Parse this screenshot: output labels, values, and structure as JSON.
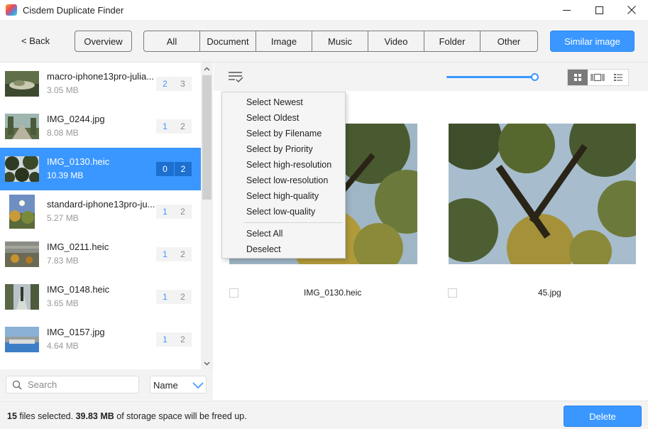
{
  "window": {
    "title": "Cisdem Duplicate Finder"
  },
  "toolbar": {
    "back_label": "< Back",
    "overview_label": "Overview",
    "tabs": [
      "All",
      "Document",
      "Image",
      "Music",
      "Video",
      "Folder",
      "Other"
    ],
    "similar_image_label": "Similar image"
  },
  "file_list": [
    {
      "name": "macro-iphone13pro-julia...",
      "size": "3.05 MB",
      "count_selected": "2",
      "count_total": "3",
      "selected": false
    },
    {
      "name": "IMG_0244.jpg",
      "size": "8.08 MB",
      "count_selected": "1",
      "count_total": "2",
      "selected": false
    },
    {
      "name": "IMG_0130.heic",
      "size": "10.39 MB",
      "count_selected": "0",
      "count_total": "2",
      "selected": true
    },
    {
      "name": "standard-iphone13pro-ju...",
      "size": "5.27 MB",
      "count_selected": "1",
      "count_total": "2",
      "selected": false
    },
    {
      "name": "IMG_0211.heic",
      "size": "7.83 MB",
      "count_selected": "1",
      "count_total": "2",
      "selected": false
    },
    {
      "name": "IMG_0148.heic",
      "size": "3.65 MB",
      "count_selected": "1",
      "count_total": "2",
      "selected": false
    },
    {
      "name": "IMG_0157.jpg",
      "size": "4.64 MB",
      "count_selected": "1",
      "count_total": "2",
      "selected": false
    }
  ],
  "search": {
    "placeholder": "Search",
    "sort_value": "Name"
  },
  "zoom": {
    "level": 1.0
  },
  "images": [
    {
      "name": "IMG_0130.heic",
      "checked": false
    },
    {
      "name": "45.jpg",
      "checked": false
    }
  ],
  "select_menu": {
    "items": [
      "Select Newest",
      "Select Oldest",
      "Select by Filename",
      "Select by Priority",
      "Select high-resolution",
      "Select low-resolution",
      "Select high-quality",
      "Select low-quality"
    ],
    "select_all": "Select All",
    "deselect": "Deselect"
  },
  "status": {
    "files_count": "15",
    "files_text": " files selected. ",
    "size": "39.83 MB",
    "size_text": " of storage space will be freed up."
  },
  "delete_label": "Delete",
  "colors": {
    "accent": "#3a97ff",
    "toolbar_bg": "#f3f3f3"
  }
}
